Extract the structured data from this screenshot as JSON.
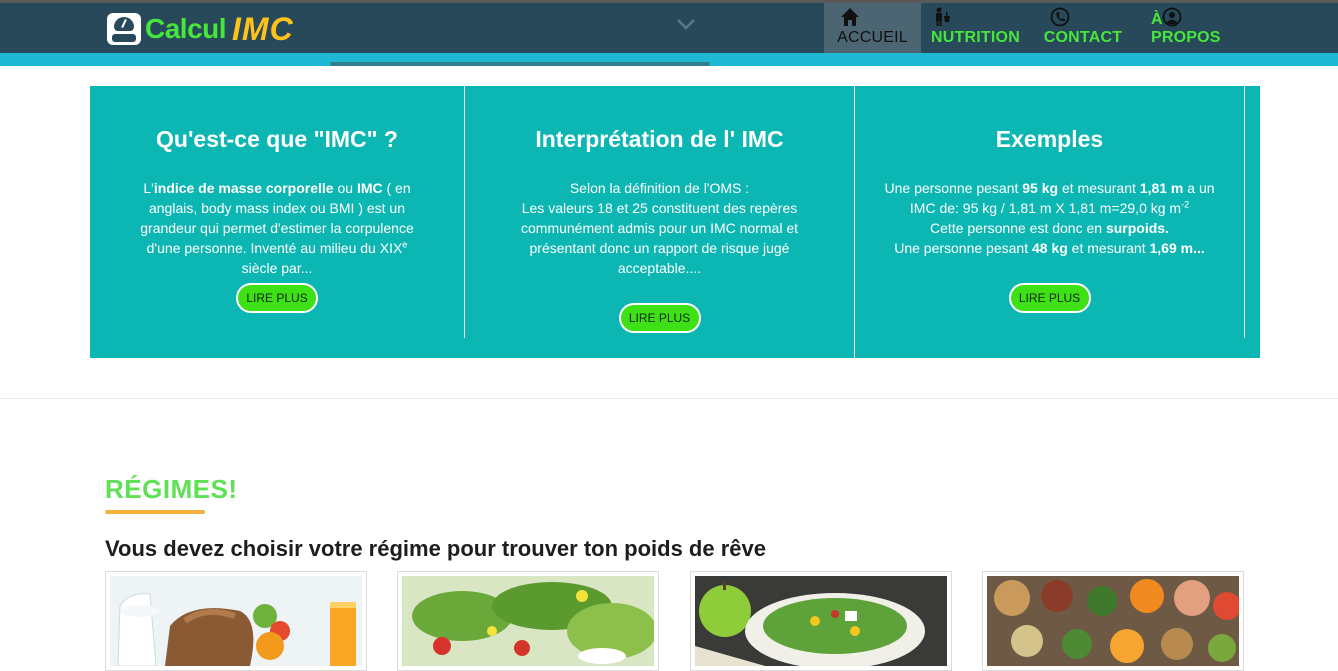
{
  "header": {
    "logo": {
      "word1": "Calcul",
      "word2": "IMC",
      "icon": "scale-icon"
    },
    "nav": [
      {
        "label": "ACCUEIL",
        "icon": "home-icon",
        "active": true
      },
      {
        "label": "NUTRITION",
        "icon": "nutrition-icon",
        "active": false
      },
      {
        "label": "CONTACT",
        "icon": "phone-icon",
        "active": false
      },
      {
        "label": "À PROPOS",
        "icon": "user-icon",
        "active": false
      }
    ]
  },
  "features": [
    {
      "title": "Qu'est-ce que \"IMC\" ?",
      "p1": "L'",
      "b1": "indice de masse corporelle",
      "p2": " ou ",
      "b2": "IMC",
      "p3": " ( en anglais, body mass index ou BMI ) est un grandeur qui permet d'estimer la corpulence d'une personne. Inventé au milieu du XIX",
      "sup": "e",
      "p4": " siècle par...",
      "button": "LIRE PLUS"
    },
    {
      "title": "Interprétation de l' IMC",
      "line1": "Selon la définition de l'OMS :",
      "line2": "Les valeurs 18 et 25 constituent des repères communément admis pour un IMC normal et présentant donc un rapport de risque jugé acceptable....",
      "button": "LIRE PLUS"
    },
    {
      "title": "Exemples",
      "a1": "Une personne pesant ",
      "a2": "95 kg",
      "a3": " et mesurant ",
      "a4": "1,81 m",
      "a5": " a un IMC de: 95 kg / 1,81 m X 1,81 m=29,0 kg m",
      "a6": "-2",
      "a7": "Cette personne est donc en ",
      "a8": "surpoids.",
      "b1": "Une personne pesant ",
      "b2": "48 kg",
      "b3": " et mesurant ",
      "b4": "1,69 m...",
      "button": "LIRE PLUS"
    }
  ],
  "regimes": {
    "title": "RÉGIMES!",
    "subtitle": "Vous devez choisir votre régime pour trouver ton poids de rêve",
    "cards": [
      {
        "image": "dairy-bread-fruit-photo"
      },
      {
        "image": "green-salad-photo"
      },
      {
        "image": "apple-salad-photo"
      },
      {
        "image": "vegetables-legumes-photo"
      }
    ]
  },
  "colors": {
    "header": "#28495a",
    "accent_strip": "#1fb8d3",
    "band": "#0cb7b3",
    "green": "#46e63a",
    "button": "#3ee016",
    "underline": "#f6b23c"
  }
}
